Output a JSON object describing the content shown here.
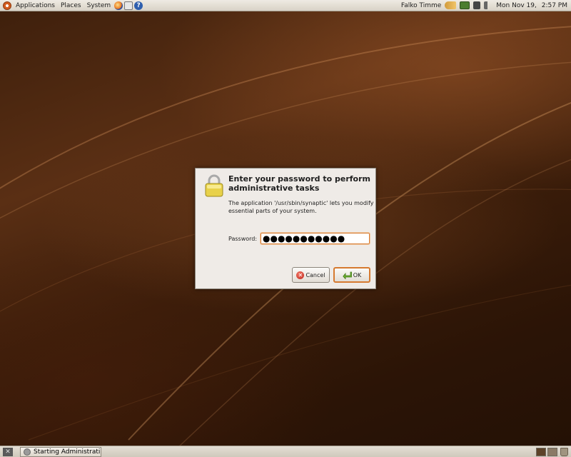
{
  "top_panel": {
    "menus": {
      "applications": "Applications",
      "places": "Places",
      "system": "System"
    },
    "user_name": "Falko Timme",
    "date": "Mon Nov 19,",
    "time": "2:57 PM",
    "icons": [
      "ubuntu-logo-icon",
      "firefox-icon",
      "mail-icon",
      "help-icon",
      "fish-applet-icon",
      "network-icon",
      "update-icon",
      "volume-icon"
    ]
  },
  "dialog": {
    "title": "Enter your password to perform administrative tasks",
    "message": "The application '/usr/sbin/synaptic' lets you modify essential parts of your system.",
    "password_label": "Password:",
    "password_value": "●●●●●●●●●●●",
    "cancel_label": "Cancel",
    "ok_label": "OK",
    "icons": [
      "lock-icon",
      "cancel-icon",
      "ok-arrow-icon"
    ]
  },
  "bottom_panel": {
    "task_label": "Starting Administrati..."
  },
  "colors": {
    "accent": "#d67a30",
    "panel": "#e4dfd5",
    "desktop": "#3b1d0a"
  }
}
